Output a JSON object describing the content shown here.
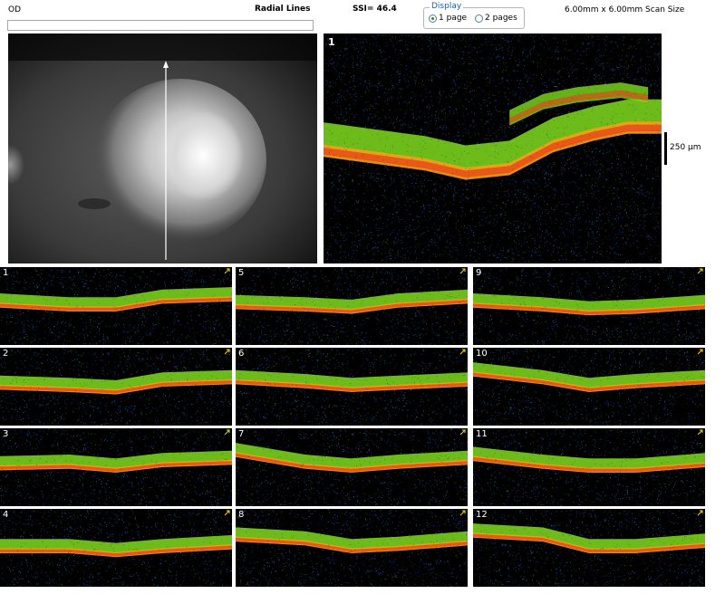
{
  "header": {
    "eye": "OD",
    "scan_pattern": "Radial Lines",
    "ssi": "SSI= 46.4",
    "scan_size": "6.00mm x 6.00mm Scan Size"
  },
  "display": {
    "legend": "Display",
    "options": [
      {
        "label": "1 page",
        "selected": true
      },
      {
        "label": "2 pages",
        "selected": false
      }
    ]
  },
  "large_scan": {
    "number": "1",
    "scale_label": "250 µm"
  },
  "thumbnails": [
    {
      "number": "1"
    },
    {
      "number": "2"
    },
    {
      "number": "3"
    },
    {
      "number": "4"
    },
    {
      "number": "5"
    },
    {
      "number": "6"
    },
    {
      "number": "7"
    },
    {
      "number": "8"
    },
    {
      "number": "9"
    },
    {
      "number": "10"
    },
    {
      "number": "11"
    },
    {
      "number": "12"
    }
  ],
  "colors": {
    "retina_green": "#7fdc1e",
    "rpe_red": "#e8401a",
    "rpe_orange": "#f5a018",
    "background": "#000000",
    "speckle_blue": "#2a5ab8"
  },
  "icons": {
    "radio_selected": "radio-on-icon",
    "radio_unselected": "radio-off-icon",
    "scan_direction": "arrow-icon"
  }
}
